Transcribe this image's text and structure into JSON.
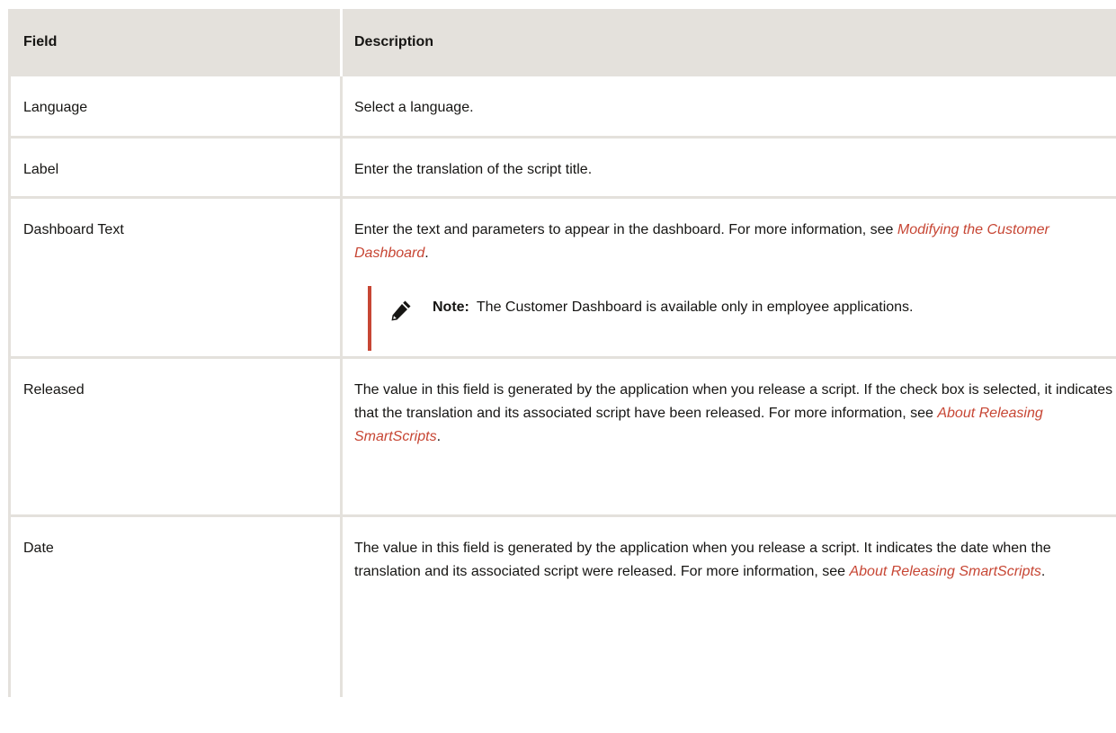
{
  "table": {
    "headers": {
      "field": "Field",
      "description": "Description"
    },
    "rows": [
      {
        "field": "Language",
        "description": "Select a language."
      },
      {
        "field": "Label",
        "description": "Enter the translation of the script title."
      },
      {
        "field": "Dashboard Text",
        "description_before": "Enter the text and parameters to appear in the dashboard. For more information, see ",
        "link": "Modifying the Customer Dashboard",
        "description_after": ".",
        "note": {
          "label": "Note:",
          "text": "The Customer Dashboard is available only in employee applications.",
          "icon": "pencil-icon"
        }
      },
      {
        "field": "Released",
        "description_before": "The value in this field is generated by the application when you release a script. If the check box is selected, it indicates that the translation and its associated script have been released. For more information, see ",
        "link": "About Releasing SmartScripts",
        "description_after": "."
      },
      {
        "field": "Date",
        "description_before": "The value in this field is generated by the application when you release a script. It indicates the date when the translation and its associated script were released. For more information, see ",
        "link": "About Releasing SmartScripts",
        "description_after": "."
      }
    ]
  },
  "colors": {
    "header_bg": "#e4e1dc",
    "link": "#c74634",
    "note_bar": "#c74634",
    "text": "#161513"
  }
}
